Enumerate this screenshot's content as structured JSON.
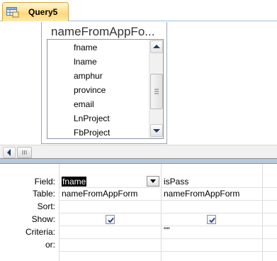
{
  "tab": {
    "label": "Query5",
    "icon": "query-icon"
  },
  "table": {
    "title": "nameFromAppFo...",
    "fields": [
      "fname",
      "lname",
      "amphur",
      "province",
      "email",
      "LnProject",
      "FbProject"
    ]
  },
  "grid": {
    "row_labels": {
      "field": "Field:",
      "table": "Table:",
      "sort": "Sort:",
      "show": "Show:",
      "criteria": "Criteria:",
      "or": "or:"
    },
    "columns": [
      {
        "field": "fname",
        "table": "nameFromAppForm",
        "sort": "",
        "show": true,
        "criteria": "",
        "or": ""
      },
      {
        "field": "isPass",
        "table": "nameFromAppForm",
        "sort": "",
        "show": true,
        "criteria": "\"\"",
        "or": ""
      }
    ]
  }
}
